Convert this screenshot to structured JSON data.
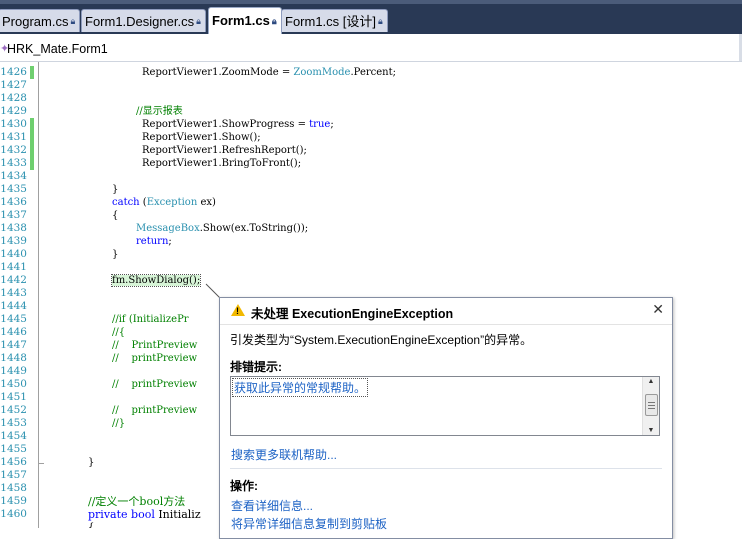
{
  "tabs": [
    {
      "label": "Program.cs",
      "active": false
    },
    {
      "label": "Form1.Designer.cs",
      "active": false
    },
    {
      "label": "Form1.cs",
      "active": true
    },
    {
      "label": "Form1.cs [设计]",
      "active": false
    }
  ],
  "navbar": {
    "label": "HRK_Mate.Form1"
  },
  "line_numbers": [
    "1426",
    "1427",
    "1428",
    "1429",
    "1430",
    "1431",
    "1432",
    "1433",
    "1434",
    "1435",
    "1436",
    "1437",
    "1438",
    "1439",
    "1440",
    "1441",
    "1442",
    "1443",
    "1444",
    "1445",
    "1446",
    "1447",
    "1448",
    "1449",
    "1450",
    "1451",
    "1452",
    "1453",
    "1454",
    "1455",
    "1456",
    "1457",
    "1458",
    "1459",
    "1460"
  ],
  "code": {
    "l1426_a": "ReportViewer1.ZoomMode = ",
    "l1426_b": "ZoomMode",
    "l1426_c": ".Percent;",
    "l1429": "//显示报表",
    "l1430_a": "ReportViewer1.ShowProgress = ",
    "l1430_b": "true",
    "l1430_c": ";",
    "l1431": "ReportViewer1.Show();",
    "l1432": "ReportViewer1.RefreshReport();",
    "l1433": "ReportViewer1.BringToFront();",
    "l1435": "}",
    "l1436_a": "catch",
    "l1436_b": " (",
    "l1436_c": "Exception",
    "l1436_d": " ex)",
    "l1437": "{",
    "l1438_a": "MessageBox",
    "l1438_b": ".Show(ex.ToString());",
    "l1439": "return",
    "l1439_b": ";",
    "l1440": "}",
    "l1442": "fm.ShowDialog();",
    "l1445": "//if (InitializePr",
    "l1446": "//{",
    "l1447": "//    PrintPreview",
    "l1448": "//    printPreview",
    "l1450": "//    printPreview",
    "l1452": "//    printPreview",
    "l1453": "//}",
    "l1456": "}",
    "l1459": "//定义一个bool方法",
    "l1460_a": "private",
    "l1460_b": " ",
    "l1460_c": "bool",
    "l1460_d": " Initializ",
    "l1461": "{"
  },
  "popup": {
    "title": "未处理 ExecutionEngineException",
    "message": "引发类型为“System.ExecutionEngineException”的异常。",
    "tips_heading": "排错提示:",
    "tip_item": "获取此异常的常规帮助。",
    "search_link": "搜索更多联机帮助...",
    "actions_heading": "操作:",
    "action_details": "查看详细信息...",
    "action_copy": "将异常详细信息复制到剪贴板",
    "close_glyph": "✕"
  }
}
